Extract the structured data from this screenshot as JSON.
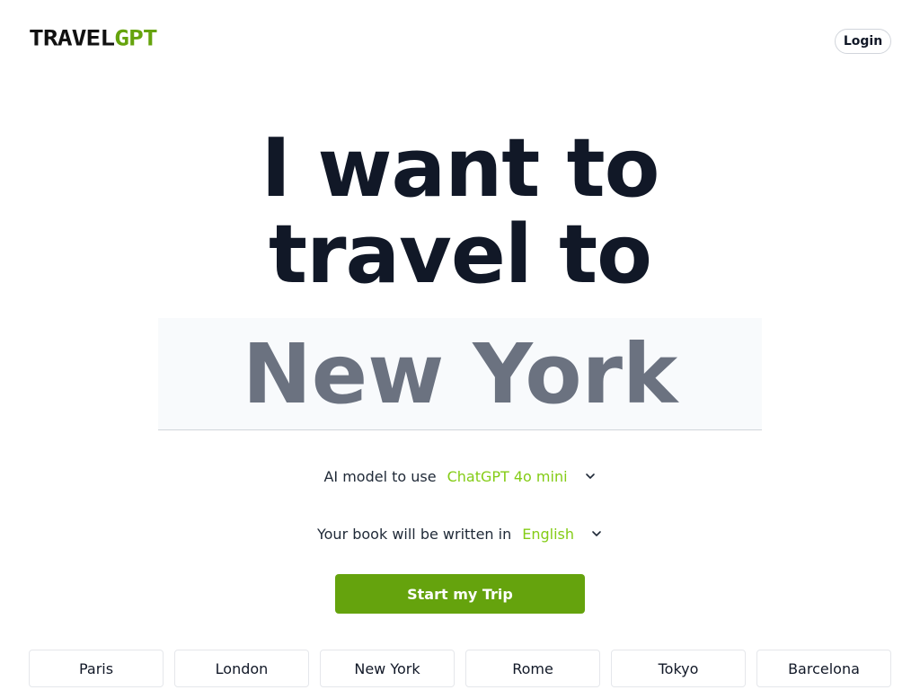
{
  "header": {
    "logo_part1": "TRAVEL",
    "logo_part2": "GPT",
    "login_label": "Login"
  },
  "hero": {
    "line1": "I want to",
    "line2": "travel to"
  },
  "destination": {
    "value": "New York"
  },
  "model_option": {
    "label": "AI model to use",
    "selected": "ChatGPT 4o mini",
    "icon": "chevron-down-icon"
  },
  "language_option": {
    "label": "Your book will be written in",
    "selected": "English",
    "icon": "chevron-down-icon"
  },
  "start_button": {
    "label": "Start my Trip"
  },
  "cities": [
    {
      "label": "Paris"
    },
    {
      "label": "London"
    },
    {
      "label": "New York"
    },
    {
      "label": "Rome"
    },
    {
      "label": "Tokyo"
    },
    {
      "label": "Barcelona"
    }
  ],
  "colors": {
    "accent_green": "#65a30d",
    "select_green": "#84cc16",
    "text_dark": "#111827",
    "muted_gray": "#6b7280"
  }
}
